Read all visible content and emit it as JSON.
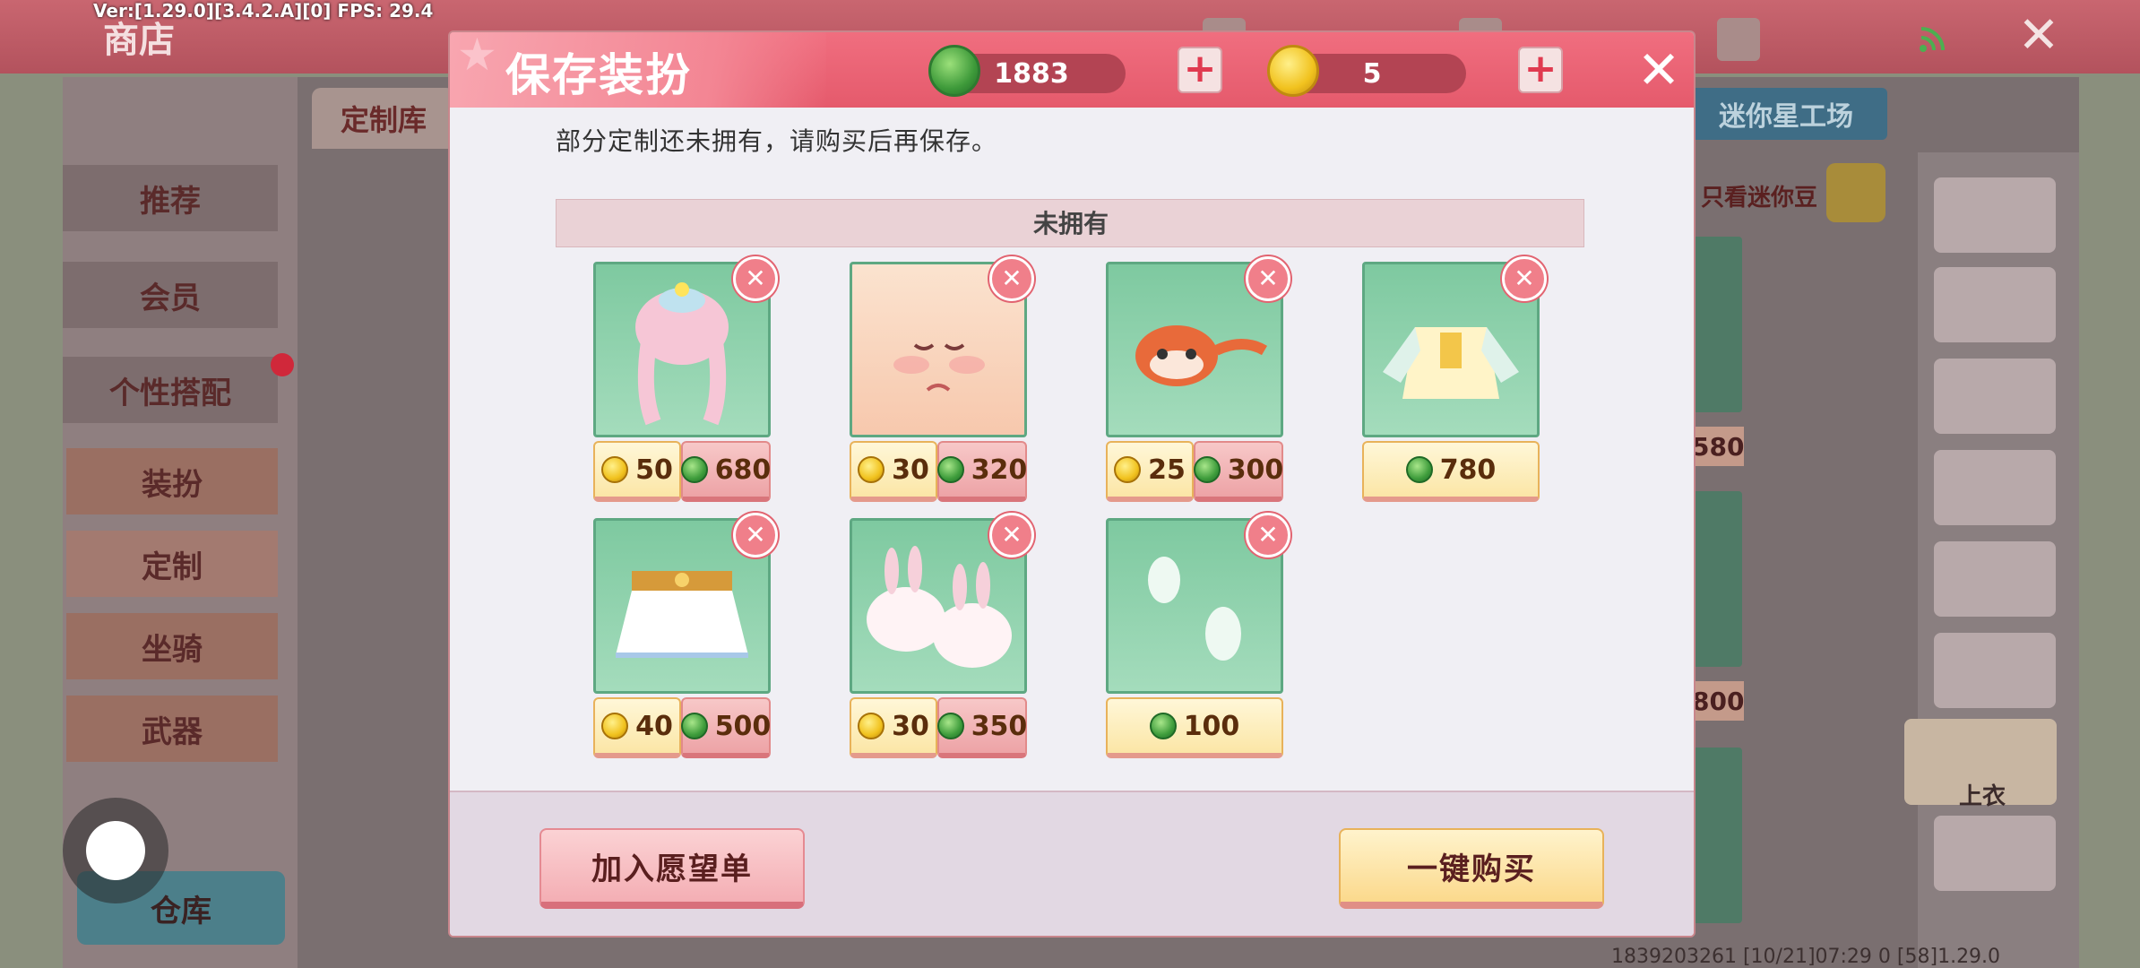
{
  "app": {
    "version_text": "Ver:[1.29.0][3.4.2.A][0] FPS: 29.4",
    "shop_title": "商店",
    "footer_id": "1839203261  [10/21]07:29 0  [58]1.29.0"
  },
  "background": {
    "nav_items": [
      "推荐",
      "会员",
      "个性搭配",
      "装扮",
      "定制",
      "坐骑",
      "武器"
    ],
    "warehouse_label": "仓库",
    "tab_custom": "定制库",
    "tab_workshop": "迷你星工场",
    "only_beans_label": "只看迷你豆",
    "rail_top_label": "上衣",
    "bg_prices": [
      "580",
      "800"
    ]
  },
  "modal": {
    "title": "保存装扮",
    "currency": {
      "gems": "1883",
      "coins": "5"
    },
    "notice": "部分定制还未拥有，请购买后再保存。",
    "section_label": "未拥有",
    "items": [
      {
        "name": "hair",
        "coin": "50",
        "gem": "680"
      },
      {
        "name": "face",
        "coin": "30",
        "gem": "320"
      },
      {
        "name": "mask",
        "coin": "25",
        "gem": "300"
      },
      {
        "name": "top",
        "coin": null,
        "gem": "780"
      },
      {
        "name": "skirt",
        "coin": "40",
        "gem": "500"
      },
      {
        "name": "shoes",
        "coin": "30",
        "gem": "350"
      },
      {
        "name": "footprint",
        "coin": null,
        "gem": "100"
      }
    ],
    "wishlist_label": "加入愿望单",
    "buy_all_label": "一键购买"
  },
  "colors": {
    "header_pink": "#e55a6c",
    "card_green": "#7ec9a0",
    "price_gold": "#fbe6a6",
    "price_pink": "#eda3a6"
  },
  "icons": [
    "gem-icon",
    "coin-icon",
    "plus-icon",
    "close-icon",
    "remove-icon",
    "wifi-icon",
    "search-icon",
    "star-icon"
  ]
}
